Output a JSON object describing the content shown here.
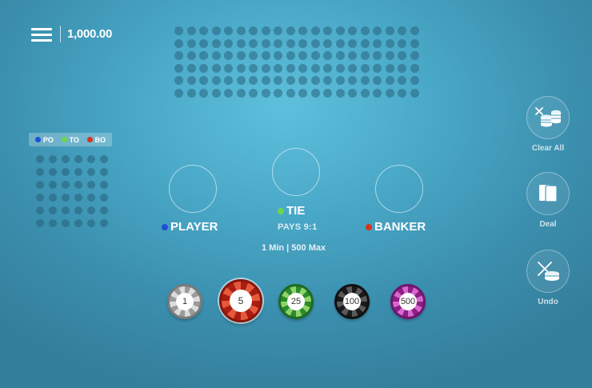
{
  "header": {
    "balance": "1,000.00"
  },
  "roadmap": {
    "legend": [
      {
        "label": "PO",
        "color": "#1e4fd8"
      },
      {
        "label": "TO",
        "color": "#6fd64a"
      },
      {
        "label": "BO",
        "color": "#d8321e"
      }
    ]
  },
  "bets": {
    "player": {
      "label": "PLAYER",
      "color": "#1e4fd8"
    },
    "tie": {
      "label": "TIE",
      "color": "#6fd64a",
      "pays": "PAYS 9:1"
    },
    "banker": {
      "label": "BANKER",
      "color": "#d8321e"
    },
    "limits": "1 Min | 500 Max"
  },
  "chips": [
    {
      "value": "1",
      "color": "#9a9a9a"
    },
    {
      "value": "5",
      "color": "#c4301d",
      "selected": true
    },
    {
      "value": "25",
      "color": "#4aa83a"
    },
    {
      "value": "100",
      "color": "#222222"
    },
    {
      "value": "500",
      "color": "#b03aa8"
    }
  ],
  "actions": {
    "clear": {
      "label": "Clear All",
      "icon": "clear-chips-icon"
    },
    "deal": {
      "label": "Deal",
      "icon": "cards-icon"
    },
    "undo": {
      "label": "Undo",
      "icon": "undo-chip-icon"
    }
  }
}
